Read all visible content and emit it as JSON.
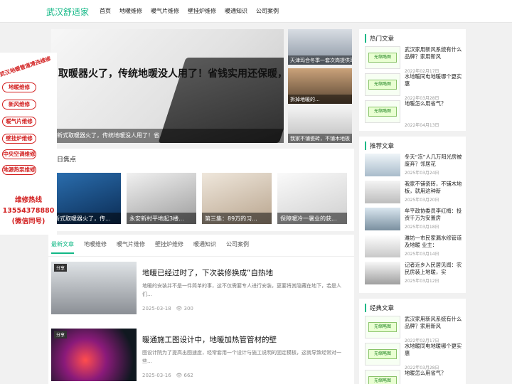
{
  "header": {
    "logo": "武汉舒适家",
    "nav": [
      "首页",
      "地暖维修",
      "暖气片维修",
      "壁挂炉维修",
      "暖通知识",
      "公司案例"
    ]
  },
  "banner": {
    "headline": "取暖器火了，传统地暖没人用了！省钱实用还保暖，真厉",
    "caption": "新式取暖器火了，传统地暖没人用了！省"
  },
  "thumbs": [
    {
      "label": "天津玛合冬季一套次岗提供率..."
    },
    {
      "label": "拆掉地暖的..."
    },
    {
      "label": "我家不铺瓷砖，不铺木地板"
    }
  ],
  "focus": {
    "title": "日焦点",
    "cards": [
      {
        "label": "新式取暖器火了，传..."
      },
      {
        "label": "永安新村平地起3楼..."
      },
      {
        "label": "第三集：89万的习..."
      },
      {
        "label": "保障暖冷一暑业的获..."
      }
    ]
  },
  "tabs": [
    "最新文章",
    "地暖维修",
    "暖气片维修",
    "壁挂炉维修",
    "暖通知识",
    "公司案例"
  ],
  "articles": [
    {
      "tag": "分享",
      "title": "地暖已经过时了，下次装修换成“自热地",
      "desc": "地暖的安装并不是一件简单的事，这不仅需要专人进行安装，更要将其隐藏在地下，若是人们...",
      "date": "2025-03-18",
      "views": "300"
    },
    {
      "tag": "分享",
      "title": "暖通施工图设计中，地暖加热管管材的壁",
      "desc": "图设计院为了提高出图速度，经常套用一个设计与施工说明的固定模板，这就导致经常对一些...",
      "date": "2025-03-16",
      "views": "662"
    }
  ],
  "sidebar": {
    "hot": {
      "title": "热门文章",
      "items": [
        {
          "title": "武汉家用新风系统有什么品牌？家用新风",
          "date": "2022年02月17日",
          "noimg": true
        },
        {
          "title": "水地暖同电地暖哪个更实惠",
          "date": "2022年03月28日",
          "noimg": true
        },
        {
          "title": "地暖怎么用省气？",
          "date": "2022年04月13日",
          "noimg": true
        }
      ]
    },
    "recommend": {
      "title": "推荐文章",
      "items": [
        {
          "title": "冬天“冻”人几万阳光房被废弃？邻居花",
          "date": "2025年03月24日"
        },
        {
          "title": "我家不铺瓷砖，不铺木地板，就用这种新",
          "date": "2025年03月20日"
        },
        {
          "title": "牟平政协委员李红梅：投资千万为安置房",
          "date": "2025年03月18日"
        },
        {
          "title": "潍坊一市民家漏水修管道及地暖 业主：",
          "date": "2025年03月14日"
        },
        {
          "title": "记者近乡入民居见闻：农民房装上地暖，实",
          "date": "2025年03月12日"
        }
      ]
    },
    "classic": {
      "title": "经典文章",
      "items": [
        {
          "title": "武汉家用新风系统有什么品牌？家用新风",
          "date": "2022年02月17日",
          "noimg": true
        },
        {
          "title": "水地暖同电地暖哪个更实惠",
          "date": "2022年03月28日",
          "noimg": true
        },
        {
          "title": "地暖怎么用省气？",
          "date": "",
          "noimg": true
        }
      ]
    },
    "noimg_label": "无缩略图"
  },
  "float_ad": {
    "slogan": "武汉地暖管道清洗维修",
    "buttons": [
      "地暖维修",
      "新风维修",
      "暖气片维修",
      "壁挂炉维修",
      "中央空调维修",
      "地源热泵维修"
    ],
    "hotline_label": "维修热线",
    "phone": "13554378880",
    "wechat": "(微信同号)"
  }
}
